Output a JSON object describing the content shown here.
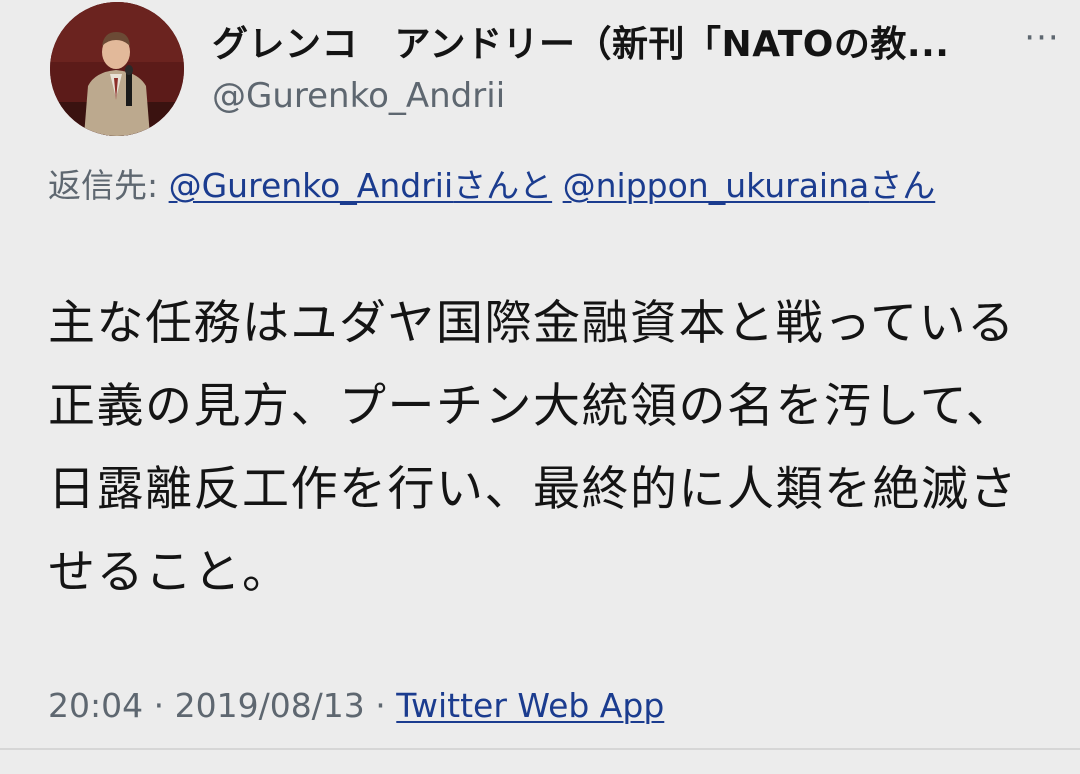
{
  "tweet": {
    "display_name": "グレンコ　アンドリー（新刊「NATOの教...",
    "handle": "@Gurenko_Andrii",
    "more_icon": "more-horizontal-icon",
    "more_label": "···",
    "reply_prefix": "返信先: ",
    "reply_mention_1": "@Gurenko_Andrii",
    "reply_joiner": "さんと",
    "reply_mention_2": "@nippon_ukuraina",
    "reply_suffix": "さん",
    "text": "主な任務はユダヤ国際金融資本と戦っている正義の見方、プーチン大統領の名を汚して、日露離反工作を行い、最終的に人類を絶滅させること。",
    "time": "20:04",
    "separator_1": " · ",
    "date": "2019/08/13",
    "separator_2": " · ",
    "source": "Twitter Web App"
  },
  "colors": {
    "background": "#ececec",
    "text": "#141414",
    "secondary_text": "#5e6770",
    "link": "#1b3c8f"
  }
}
